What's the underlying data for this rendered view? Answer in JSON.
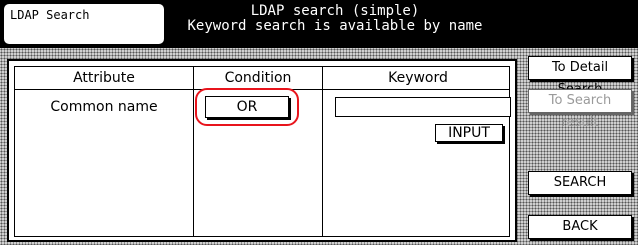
{
  "header": {
    "tab_label": "LDAP Search",
    "title_line1": "LDAP search (simple)",
    "title_line2": "Keyword search is available by name"
  },
  "table": {
    "columns": [
      "Attribute",
      "Condition",
      "Keyword"
    ],
    "row": {
      "attribute": "Common name",
      "condition": "OR",
      "keyword_value": ""
    },
    "input_button": "INPUT"
  },
  "side_buttons": {
    "detail": "To Detail Search",
    "result": "To Search result",
    "search": "SEARCH",
    "back": "BACK"
  },
  "colors": {
    "highlight": "#e8141c"
  }
}
